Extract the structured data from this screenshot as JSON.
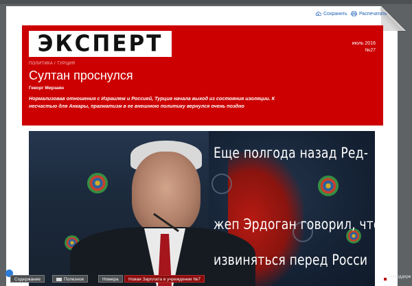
{
  "toolbar": {
    "save_label": "Сохранить",
    "print_label": "Распечатать"
  },
  "header": {
    "logo": "ЭКСПЕРТ",
    "issue_month": "июль 2016",
    "issue_number": "№27",
    "rubric": "ПОЛИТИКА / ТУРЦИЯ",
    "title": "Султан проснулся",
    "author": "Геворг Мирзаян",
    "lead": "Нормализовав отношения с Израилем и Россией, Турция начала выход из состояния изоляции. К несчастью для Анкары, прагматизм в ее внешнюю политику вернулся очень поздно"
  },
  "pull_quote": {
    "line1": "Еще полгода назад Ред-",
    "line2": "",
    "line3": "жеп Эрдоган говорил, что",
    "line4": "извиняться перед Росси"
  },
  "bottom_bar": {
    "contents": "Содержание",
    "useful": "Полезное",
    "issues": "Номера",
    "promo": "Новая Зарплата в учреждении №7",
    "corner": "Техподдерж"
  },
  "colors": {
    "header_red": "#cc0000",
    "link_blue": "#1c5fb3",
    "page_bg": "#5f6264"
  }
}
